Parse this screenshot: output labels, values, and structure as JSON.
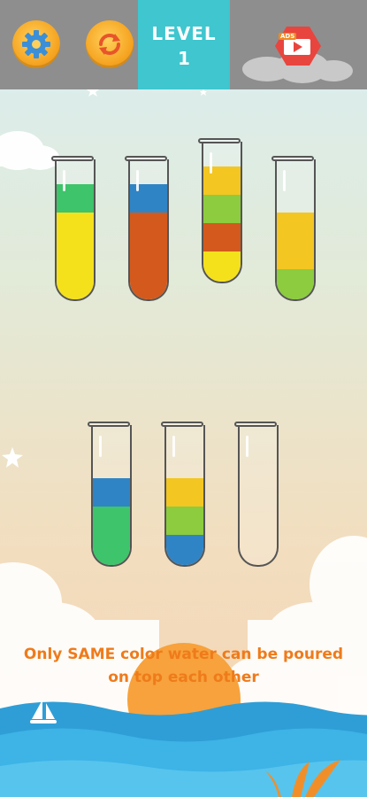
{
  "top_bar": {
    "level_label": "LEVEL",
    "level_number": "1",
    "settings_icon": "gear-icon",
    "restart_icon": "restart-icon",
    "ad_icon": "video-ad-icon",
    "ad_badge_text": "ADS"
  },
  "colors": {
    "yellow": "#f4e11c",
    "green": "#3ec46a",
    "orange": "#d35a1c",
    "blue": "#2f84c6",
    "lime": "#8ccc3e",
    "gold": "#f3c622",
    "accent": "#3fc6cf",
    "hint_text": "#ef7b1a"
  },
  "tubes": [
    {
      "segments": [
        "green",
        "yellow",
        "yellow",
        "yellow"
      ]
    },
    {
      "segments": [
        "blue",
        "orange",
        "orange",
        "orange"
      ]
    },
    {
      "segments": [
        "gold",
        "lime",
        "orange",
        "yellow"
      ]
    },
    {
      "segments": [
        "empty",
        "gold",
        "gold",
        "lime"
      ]
    },
    {
      "segments": [
        "empty",
        "blue",
        "green",
        "green"
      ]
    },
    {
      "segments": [
        "empty",
        "gold",
        "lime",
        "blue"
      ]
    },
    {
      "segments": [
        "empty",
        "empty",
        "empty",
        "empty"
      ]
    }
  ],
  "hint": {
    "line1": "Only SAME color water can be poured",
    "line2": "on top each other"
  }
}
